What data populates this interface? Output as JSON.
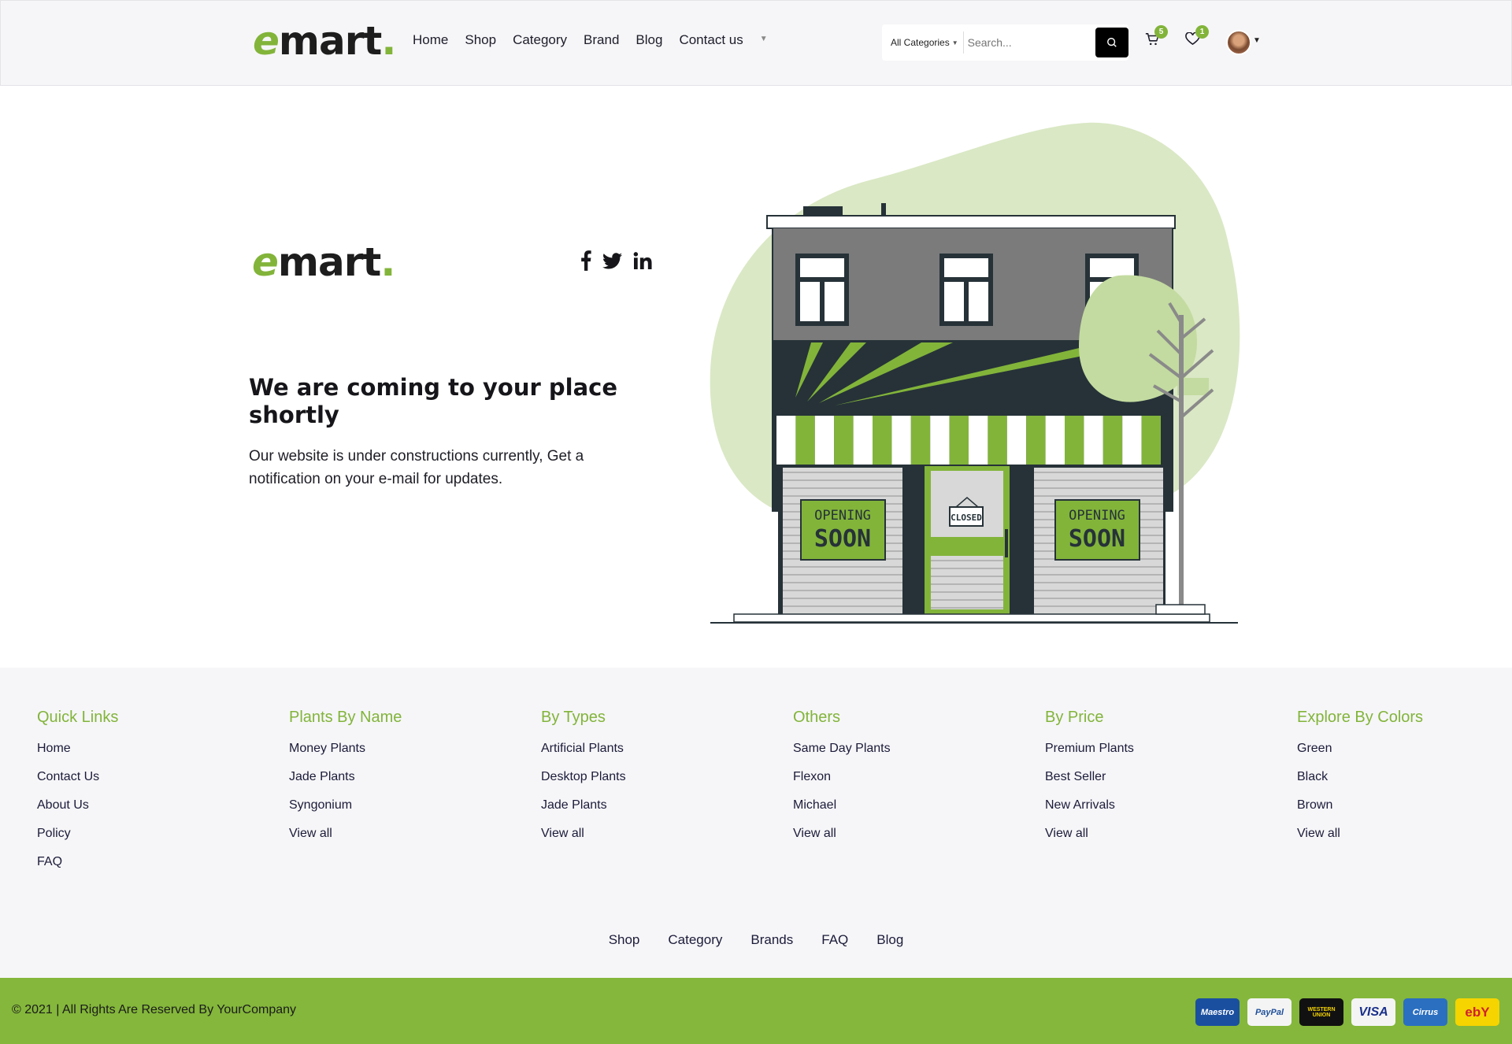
{
  "brand": {
    "logo_e": "e",
    "logo_rest": "mart",
    "logo_dot": "."
  },
  "nav": {
    "items": [
      "Home",
      "Shop",
      "Category",
      "Brand",
      "Blog",
      "Contact us"
    ]
  },
  "search": {
    "category": "All Categories",
    "placeholder": "Search..."
  },
  "header_icons": {
    "cart_count": "5",
    "wishlist_count": "1"
  },
  "hero": {
    "title": "We are coming to your place shortly",
    "description": "Our website is under constructions currently, Get a notification on your e-mail for updates.",
    "sign_closed": "CLOSED",
    "sign_opening": "OPENING",
    "sign_soon": "SOON"
  },
  "footer": {
    "columns": [
      {
        "title": "Quick Links",
        "links": [
          "Home",
          "Contact Us",
          "About Us",
          "Policy",
          "FAQ"
        ]
      },
      {
        "title": "Plants By Name",
        "links": [
          "Money Plants",
          "Jade Plants",
          "Syngonium",
          "View all"
        ]
      },
      {
        "title": "By Types",
        "links": [
          "Artificial Plants",
          "Desktop Plants",
          "Jade Plants",
          "View all"
        ]
      },
      {
        "title": "Others",
        "links": [
          "Same Day Plants",
          "Flexon",
          "Michael",
          "View all"
        ]
      },
      {
        "title": "By Price",
        "links": [
          "Premium Plants",
          "Best Seller",
          "New Arrivals",
          "View all"
        ]
      },
      {
        "title": "Explore By Colors",
        "links": [
          "Green",
          "Black",
          "Brown",
          "View all"
        ]
      }
    ],
    "bottom_links": [
      "Shop",
      "Category",
      "Brands",
      "FAQ",
      "Blog"
    ],
    "copyright": "© 2021 | All Rights Are Reserved By YourCompany",
    "payments": [
      "Maestro",
      "PayPal",
      "WESTERN UNION",
      "VISA",
      "Cirrus",
      "ebY"
    ]
  },
  "colors": {
    "accent": "#82b43a",
    "dark": "#263238",
    "footer_bg": "#f6f6f8",
    "copybar_bg": "#84b73b"
  }
}
